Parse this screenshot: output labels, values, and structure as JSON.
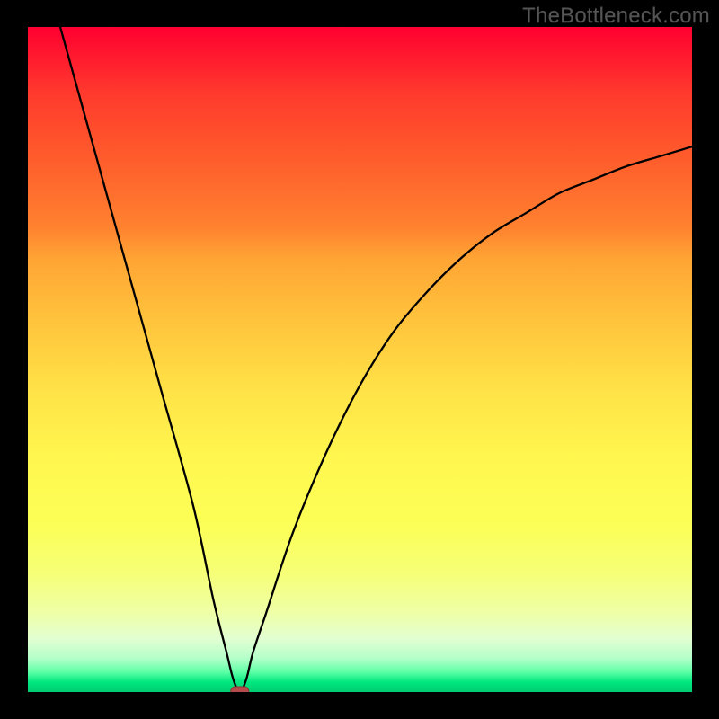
{
  "watermark": "TheBottleneck.com",
  "chart_data": {
    "type": "line",
    "title": "",
    "xlabel": "",
    "ylabel": "",
    "xlim": [
      0,
      100
    ],
    "ylim": [
      0,
      100
    ],
    "background": {
      "gradient_direction": "vertical",
      "top_color": "#ff0030",
      "bottom_color": "#00cc71",
      "meaning": "red = high bottleneck, green = low bottleneck"
    },
    "series": [
      {
        "name": "bottleneck-curve",
        "type": "line",
        "x": [
          5,
          10,
          15,
          20,
          25,
          28,
          30,
          31,
          32,
          33,
          34,
          36,
          40,
          45,
          50,
          55,
          60,
          65,
          70,
          75,
          80,
          85,
          90,
          95,
          100
        ],
        "y": [
          100,
          82,
          64,
          46,
          28,
          14,
          6,
          2,
          0,
          2,
          6,
          12,
          24,
          36,
          46,
          54,
          60,
          65,
          69,
          72,
          75,
          77,
          79,
          80.5,
          82
        ]
      }
    ],
    "marker": {
      "name": "selected-config",
      "x": 32,
      "y": 0,
      "shape": "rounded-rect",
      "color": "#b74a4a"
    },
    "annotations": []
  }
}
